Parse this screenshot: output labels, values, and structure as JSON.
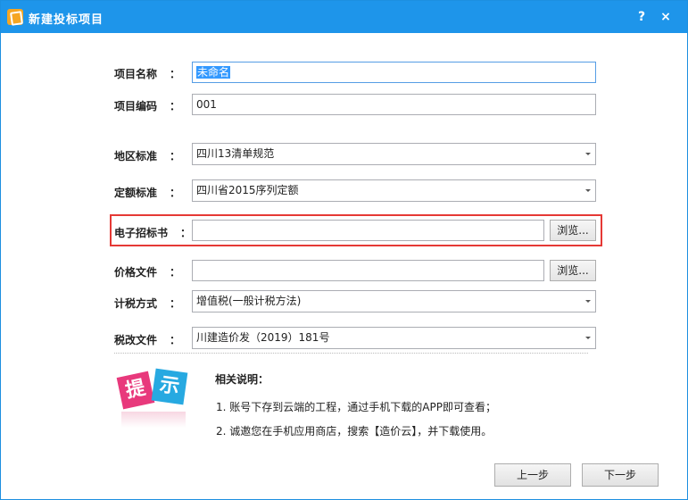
{
  "titlebar": {
    "title": "新建投标项目",
    "help": "?",
    "close": "×"
  },
  "form": {
    "project_name": {
      "label": "项目名称",
      "colon": "：",
      "value": "未命名"
    },
    "project_code": {
      "label": "项目编码",
      "colon": "：",
      "value": "001"
    },
    "region_standard": {
      "label": "地区标准",
      "colon": "：",
      "value": "四川13清单规范"
    },
    "quota_standard": {
      "label": "定额标准",
      "colon": "：",
      "value": "四川省2015序列定额"
    },
    "tender_doc": {
      "label": "电子招标书",
      "colon": "：",
      "value": "",
      "browse": "浏览..."
    },
    "price_file": {
      "label": "价格文件",
      "colon": "：",
      "value": "",
      "browse": "浏览..."
    },
    "tax_method": {
      "label": "计税方式",
      "colon": "：",
      "value": "增值税(一般计税方法)"
    },
    "tax_reform_file": {
      "label": "税改文件",
      "colon": "：",
      "value": "川建造价发（2019）181号"
    }
  },
  "tips": {
    "icon_text_a": "提",
    "icon_text_b": "示",
    "title": "相关说明：",
    "items": [
      "1. 账号下存到云端的工程，通过手机下载的APP即可查看；",
      "2. 诚邀您在手机应用商店，搜索【造价云】，并下载使用。"
    ]
  },
  "footer": {
    "prev": "上一步",
    "next": "下一步"
  },
  "colors": {
    "titlebar": "#1e95ea",
    "highlight": "#e53935",
    "selection": "#3399ff"
  }
}
